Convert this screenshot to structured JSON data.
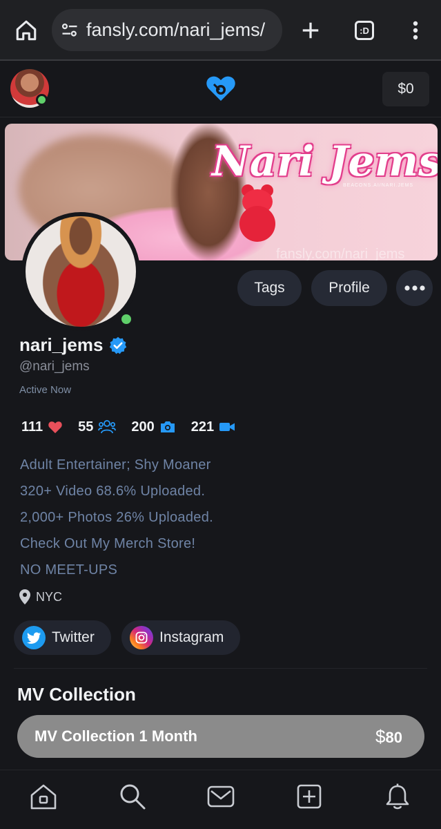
{
  "browser": {
    "url": "fansly.com/nari_jems/",
    "tabs_count": ":D"
  },
  "header": {
    "wallet": "$0"
  },
  "banner": {
    "title": "Nari Jems",
    "subtitle": "BEACONS.AI/NARI.JEMS",
    "watermark": "fansly.com/nari_jems"
  },
  "profile": {
    "display_name": "nari_jems",
    "handle": "@nari_jems",
    "status": "Active Now",
    "actions": {
      "tags": "Tags",
      "profile": "Profile"
    },
    "stats": {
      "likes": "111",
      "followers": "55",
      "photos": "200",
      "videos": "221"
    },
    "bio": [
      "Adult Entertainer; Shy Moaner",
      "320+ Video 68.6% Uploaded.",
      "2,000+ Photos 26% Uploaded.",
      "Check Out My Merch Store!",
      "NO MEET-UPS"
    ],
    "location": "NYC",
    "socials": {
      "twitter": "Twitter",
      "instagram": "Instagram"
    }
  },
  "subscriptions": {
    "section_title": "MV Collection",
    "tier_label": "MV Collection 1 Month",
    "currency": "$",
    "price": "80"
  },
  "colors": {
    "accent": "#2699f7",
    "online": "#5fcf6a",
    "like": "#e8505b",
    "background": "#16171b"
  }
}
